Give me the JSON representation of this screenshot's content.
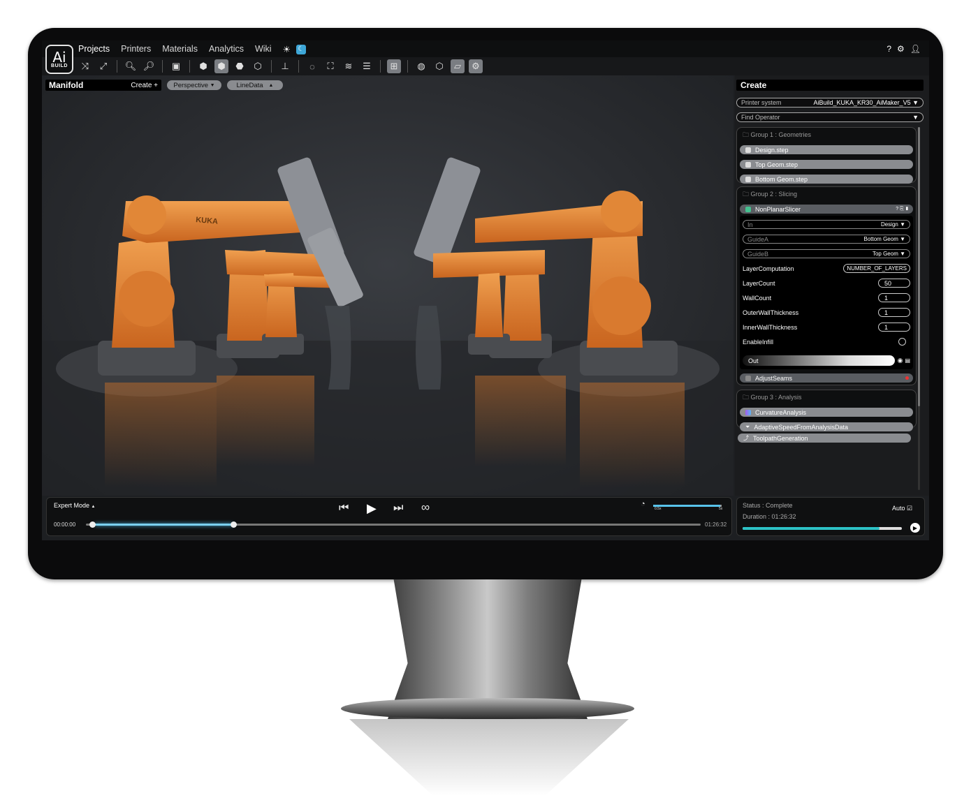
{
  "menu": {
    "logo_main": "Ai",
    "logo_sub": "BUILD",
    "items": [
      "Projects",
      "Printers",
      "Materials",
      "Analytics",
      "Wiki"
    ],
    "right_icons": [
      "help-icon",
      "gear-icon",
      "user-icon"
    ],
    "help": "?"
  },
  "viewport": {
    "manifold_title": "Manifold",
    "create_label": "Create +",
    "camera_mode": "Perspective",
    "camera_arrow": "▼",
    "display_mode": "LineData",
    "display_arrow": "▲",
    "robot_brand": "KUKA"
  },
  "panel": {
    "title": "Create",
    "printer_label": "Printer system",
    "printer_value": "AiBuild_KUKA_KR30_AiMaker_V5",
    "find_operator": "Find Operator",
    "group1": {
      "title": "Group 1 : Geometries",
      "items": [
        "Design.step",
        "Top Geom.step",
        "Bottom Geom.step"
      ]
    },
    "group2": {
      "title": "Group 2 : Slicing",
      "operator": "NonPlanarSlicer",
      "inputs": [
        {
          "label": "In",
          "value": "Design"
        },
        {
          "label": "GuideA",
          "value": "Bottom Geom"
        },
        {
          "label": "GuideB",
          "value": "Top Geom"
        }
      ],
      "params": [
        {
          "label": "LayerComputation",
          "value": "NUMBER_OF_LAYERS"
        },
        {
          "label": "LayerCount",
          "value": "50"
        },
        {
          "label": "WallCount",
          "value": "1"
        },
        {
          "label": "OuterWallThickness",
          "value": "1"
        },
        {
          "label": "InnerWallThickness",
          "value": "1"
        },
        {
          "label": "EnableInfill",
          "value": ""
        }
      ],
      "out_label": "Out",
      "next_operator": "AdjustSeams"
    },
    "group3": {
      "title": "Group 3 : Analysis",
      "items": [
        "CurvatureAnalysis",
        "AdaptiveSpeedFromAnalysisData"
      ]
    },
    "toolpath": "ToolpathGeneration"
  },
  "playback": {
    "mode": "Expert Mode",
    "mode_arrow": "▲",
    "time_start": "00:00:00",
    "time_end": "01:26:32",
    "progress_fraction": 0.24,
    "speed_min": "0.5x",
    "speed_max": "5x",
    "speed_fraction": 0.98
  },
  "status": {
    "status_text": "Status : Complete",
    "duration_text": "Duration : 01:26:32",
    "auto_label": "Auto",
    "progress_fraction": 0.86
  },
  "colors": {
    "accent": "#58c3ea",
    "robot_orange": "#e8893a",
    "status_progress": "#2cc2c6"
  }
}
